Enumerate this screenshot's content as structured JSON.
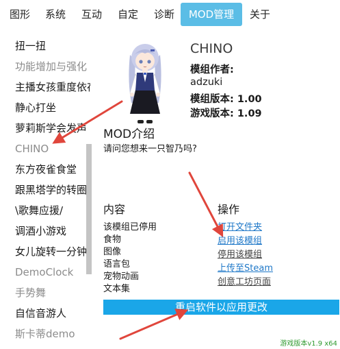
{
  "menu": {
    "items": [
      {
        "label": "图形"
      },
      {
        "label": "系统"
      },
      {
        "label": "互动"
      },
      {
        "label": "自定"
      },
      {
        "label": "诊断"
      },
      {
        "label": "MOD管理"
      },
      {
        "label": "关于"
      }
    ],
    "active_index": 5,
    "accent_color": "#5bbde6"
  },
  "mod_list": [
    {
      "label": "扭一扭",
      "state": "active"
    },
    {
      "label": "功能增加与强化",
      "state": "inactive"
    },
    {
      "label": "主播女孩重度依存",
      "state": "active"
    },
    {
      "label": "静心打坐",
      "state": "active"
    },
    {
      "label": "萝莉斯学会发声",
      "state": "active"
    },
    {
      "label": "CHINO",
      "state": "inactive"
    },
    {
      "label": "东方夜雀食堂",
      "state": "active"
    },
    {
      "label": "跟黑塔学的转圈",
      "state": "active"
    },
    {
      "label": "\\歌舞应援/",
      "state": "active"
    },
    {
      "label": "调酒小游戏",
      "state": "active"
    },
    {
      "label": "女儿旋转一分钟",
      "state": "active"
    },
    {
      "label": "DemoClock",
      "state": "inactive"
    },
    {
      "label": "手势舞",
      "state": "inactive"
    },
    {
      "label": "自信音游人",
      "state": "active"
    },
    {
      "label": "斯卡蒂demo",
      "state": "inactive"
    }
  ],
  "mod_info": {
    "name": "CHINO",
    "author_label": "模组作者:",
    "author": "adzuki",
    "mod_version_label": "模组版本: 1.00",
    "game_version_label": "游戏版本: 1.09",
    "intro_title": "MOD介绍",
    "intro_text": "请问您想来一只智乃吗?"
  },
  "content": {
    "title": "内容",
    "items": [
      "该模组已停用",
      "食物",
      "图像",
      "语言包",
      "宠物动画",
      "文本集"
    ]
  },
  "actions": {
    "title": "操作",
    "links": [
      {
        "label": "打开文件夹"
      },
      {
        "label": "启用该模组"
      },
      {
        "label": "停用该模组"
      },
      {
        "label": "上传至Steam"
      },
      {
        "label": "创意工坊页面"
      }
    ]
  },
  "restart_button": "重启软件以应用更改",
  "version": "游戏版本v1.9 x64",
  "colors": {
    "link": "#1f78c8",
    "restart_bar": "#1aa6e8",
    "arrow": "#e0463c",
    "version": "#2e9a2e"
  }
}
